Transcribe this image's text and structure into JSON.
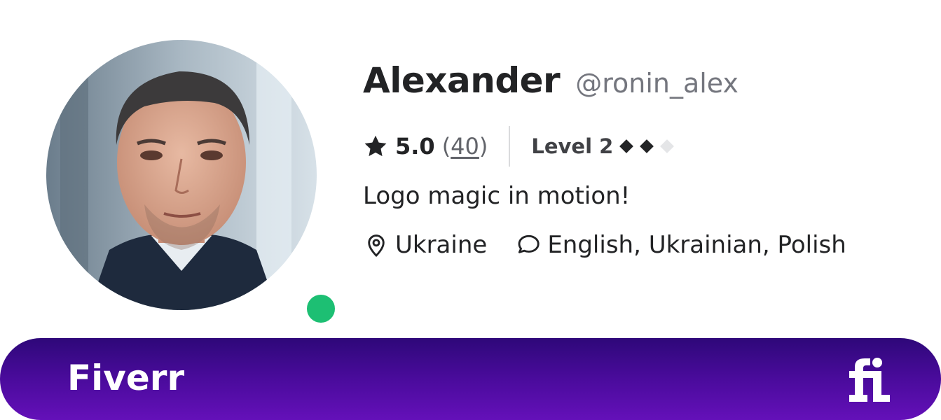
{
  "profile": {
    "name": "Alexander",
    "username": "@ronin_alex",
    "rating": "5.0",
    "reviews_open": "(",
    "reviews_count": "40",
    "reviews_close": ")",
    "level": "Level 2",
    "level_filled": 2,
    "level_total": 3,
    "tagline": "Logo magic in motion!",
    "location": "Ukraine",
    "languages": "English, Ukrainian, Polish",
    "online": true
  },
  "banner": {
    "brand": "Fiverr",
    "logo_icon": "fiverr-fi-logo"
  },
  "colors": {
    "online": "#1dbf73",
    "banner_top": "#2e0879",
    "banner_bottom": "#6410b9",
    "text": "#222325",
    "muted": "#74767e",
    "diamond_on": "#222325",
    "diamond_off": "#e4e5e7"
  },
  "icons": {
    "star": "star-icon",
    "location": "map-pin-icon",
    "language": "speech-bubble-icon"
  }
}
